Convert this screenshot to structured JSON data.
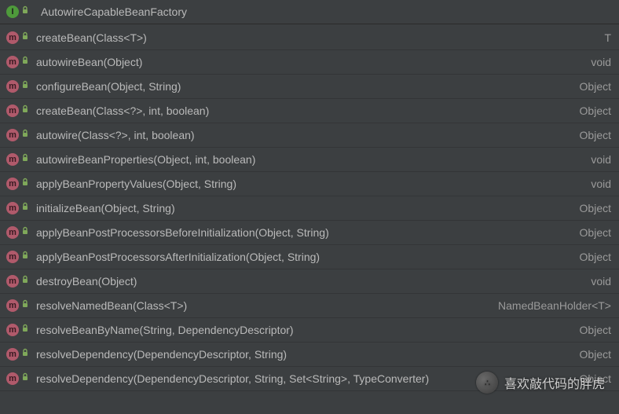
{
  "header": {
    "title": "AutowireCapableBeanFactory",
    "icon": "interface-icon"
  },
  "methods": [
    {
      "name": "createBean(Class<T>)",
      "returnType": "T"
    },
    {
      "name": "autowireBean(Object)",
      "returnType": "void"
    },
    {
      "name": "configureBean(Object, String)",
      "returnType": "Object"
    },
    {
      "name": "createBean(Class<?>, int, boolean)",
      "returnType": "Object"
    },
    {
      "name": "autowire(Class<?>, int, boolean)",
      "returnType": "Object"
    },
    {
      "name": "autowireBeanProperties(Object, int, boolean)",
      "returnType": "void"
    },
    {
      "name": "applyBeanPropertyValues(Object, String)",
      "returnType": "void"
    },
    {
      "name": "initializeBean(Object, String)",
      "returnType": "Object"
    },
    {
      "name": "applyBeanPostProcessorsBeforeInitialization(Object, String)",
      "returnType": "Object"
    },
    {
      "name": "applyBeanPostProcessorsAfterInitialization(Object, String)",
      "returnType": "Object"
    },
    {
      "name": "destroyBean(Object)",
      "returnType": "void"
    },
    {
      "name": "resolveNamedBean(Class<T>)",
      "returnType": "NamedBeanHolder<T>"
    },
    {
      "name": "resolveBeanByName(String, DependencyDescriptor)",
      "returnType": "Object"
    },
    {
      "name": "resolveDependency(DependencyDescriptor, String)",
      "returnType": "Object"
    },
    {
      "name": "resolveDependency(DependencyDescriptor, String, Set<String>, TypeConverter)",
      "returnType": "Object"
    }
  ],
  "watermark": {
    "text": "喜欢敲代码的胖虎"
  },
  "colors": {
    "background": "#3c3f41",
    "methodIconBg": "#b05a6b",
    "interfaceIconBg": "#4e9a3b",
    "lock": "#7fa85a",
    "text": "#bababa",
    "returnText": "#9a9a9a"
  }
}
